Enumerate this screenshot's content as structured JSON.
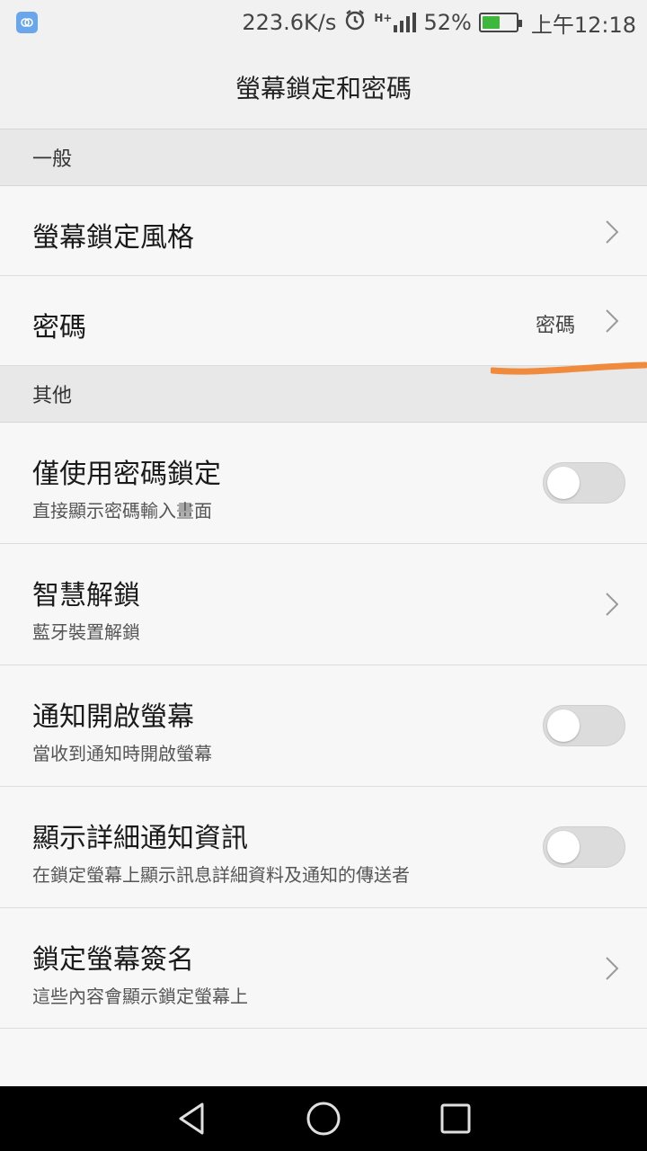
{
  "status_bar": {
    "net_speed": "223.6K/s",
    "network_type": "H+",
    "battery_percent": "52%",
    "battery_level": 0.52,
    "time": "上午12:18",
    "icons": [
      "app-notification-icon",
      "alarm-icon",
      "signal-icon",
      "battery-charging-icon"
    ]
  },
  "header": {
    "title": "螢幕鎖定和密碼"
  },
  "sections": {
    "general": {
      "label": "一般"
    },
    "other": {
      "label": "其他"
    }
  },
  "rows": {
    "lock_style": {
      "title": "螢幕鎖定風格"
    },
    "password": {
      "title": "密碼",
      "value": "密碼"
    },
    "password_only": {
      "title": "僅使用密碼鎖定",
      "subtitle": "直接顯示密碼輸入畫面",
      "enabled": false
    },
    "smart_unlock": {
      "title": "智慧解鎖",
      "subtitle": "藍牙裝置解鎖"
    },
    "wake_on_notify": {
      "title": "通知開啟螢幕",
      "subtitle": "當收到通知時開啟螢幕",
      "enabled": false
    },
    "detailed_notify": {
      "title": "顯示詳細通知資訊",
      "subtitle": "在鎖定螢幕上顯示訊息詳細資料及通知的傳送者",
      "enabled": false
    },
    "lock_signature": {
      "title": "鎖定螢幕簽名",
      "subtitle": "這些內容會顯示鎖定螢幕上"
    }
  },
  "colors": {
    "annotation": "#f08a3c",
    "battery_fill": "#3db83d",
    "app_badge": "#6aa6ec"
  },
  "nav": {
    "icons": [
      "back-icon",
      "home-icon",
      "recents-icon"
    ]
  }
}
